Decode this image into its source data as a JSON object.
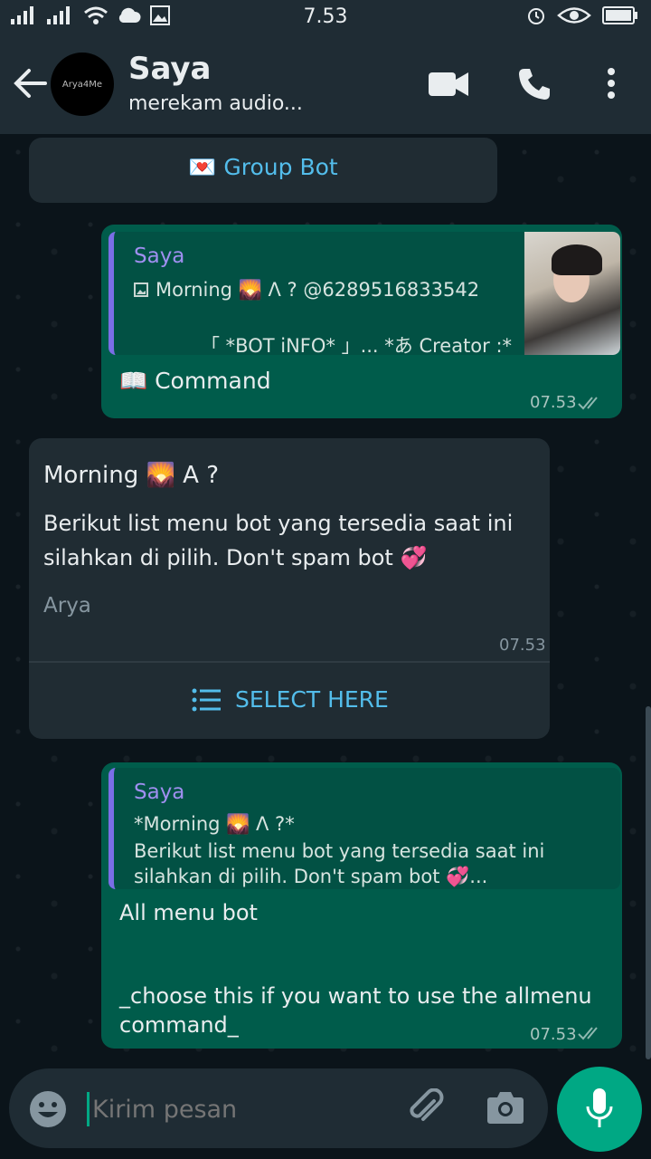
{
  "status_bar": {
    "time": "7.53"
  },
  "header": {
    "avatar_text": "Arya4Me",
    "contact_name": "Saya",
    "contact_status": "merekam audio..."
  },
  "messages": {
    "system_pill": {
      "emoji": "💌",
      "text": "Group Bot"
    },
    "msg1": {
      "quote_name": "Saya",
      "quote_line1": "Morning 🌄 Λ ? @6289516833542",
      "quote_line2": "「 *BOT iNFO* 」... *あ Creator :*",
      "body": "📖 Command",
      "time": "07.53"
    },
    "msg2": {
      "title": "Morning 🌄 A ?",
      "body_line1": "Berikut list menu bot yang tersedia saat ini",
      "body_line2": "silahkan di pilih. Don't spam bot 💞",
      "footer": "Arya",
      "time": "07.53",
      "button": "SELECT HERE"
    },
    "msg3": {
      "quote_name": "Saya",
      "quote_line1": "*Morning 🌄 Λ ?*",
      "quote_line2": "Berikut list menu bot yang tersedia saat ini",
      "quote_line3": "silahkan di pilih. Don't spam bot 💞...",
      "body_line1": "All menu bot",
      "body_line2": "_choose this if you want to use the allmenu",
      "body_line3": "command_",
      "time": "07.53"
    }
  },
  "input": {
    "placeholder": "Kirim pesan"
  },
  "colors": {
    "accent": "#00a884",
    "outgoing": "#005c4b",
    "incoming": "#202c33",
    "link": "#53bdeb",
    "quote_name": "#9f8ff0"
  }
}
